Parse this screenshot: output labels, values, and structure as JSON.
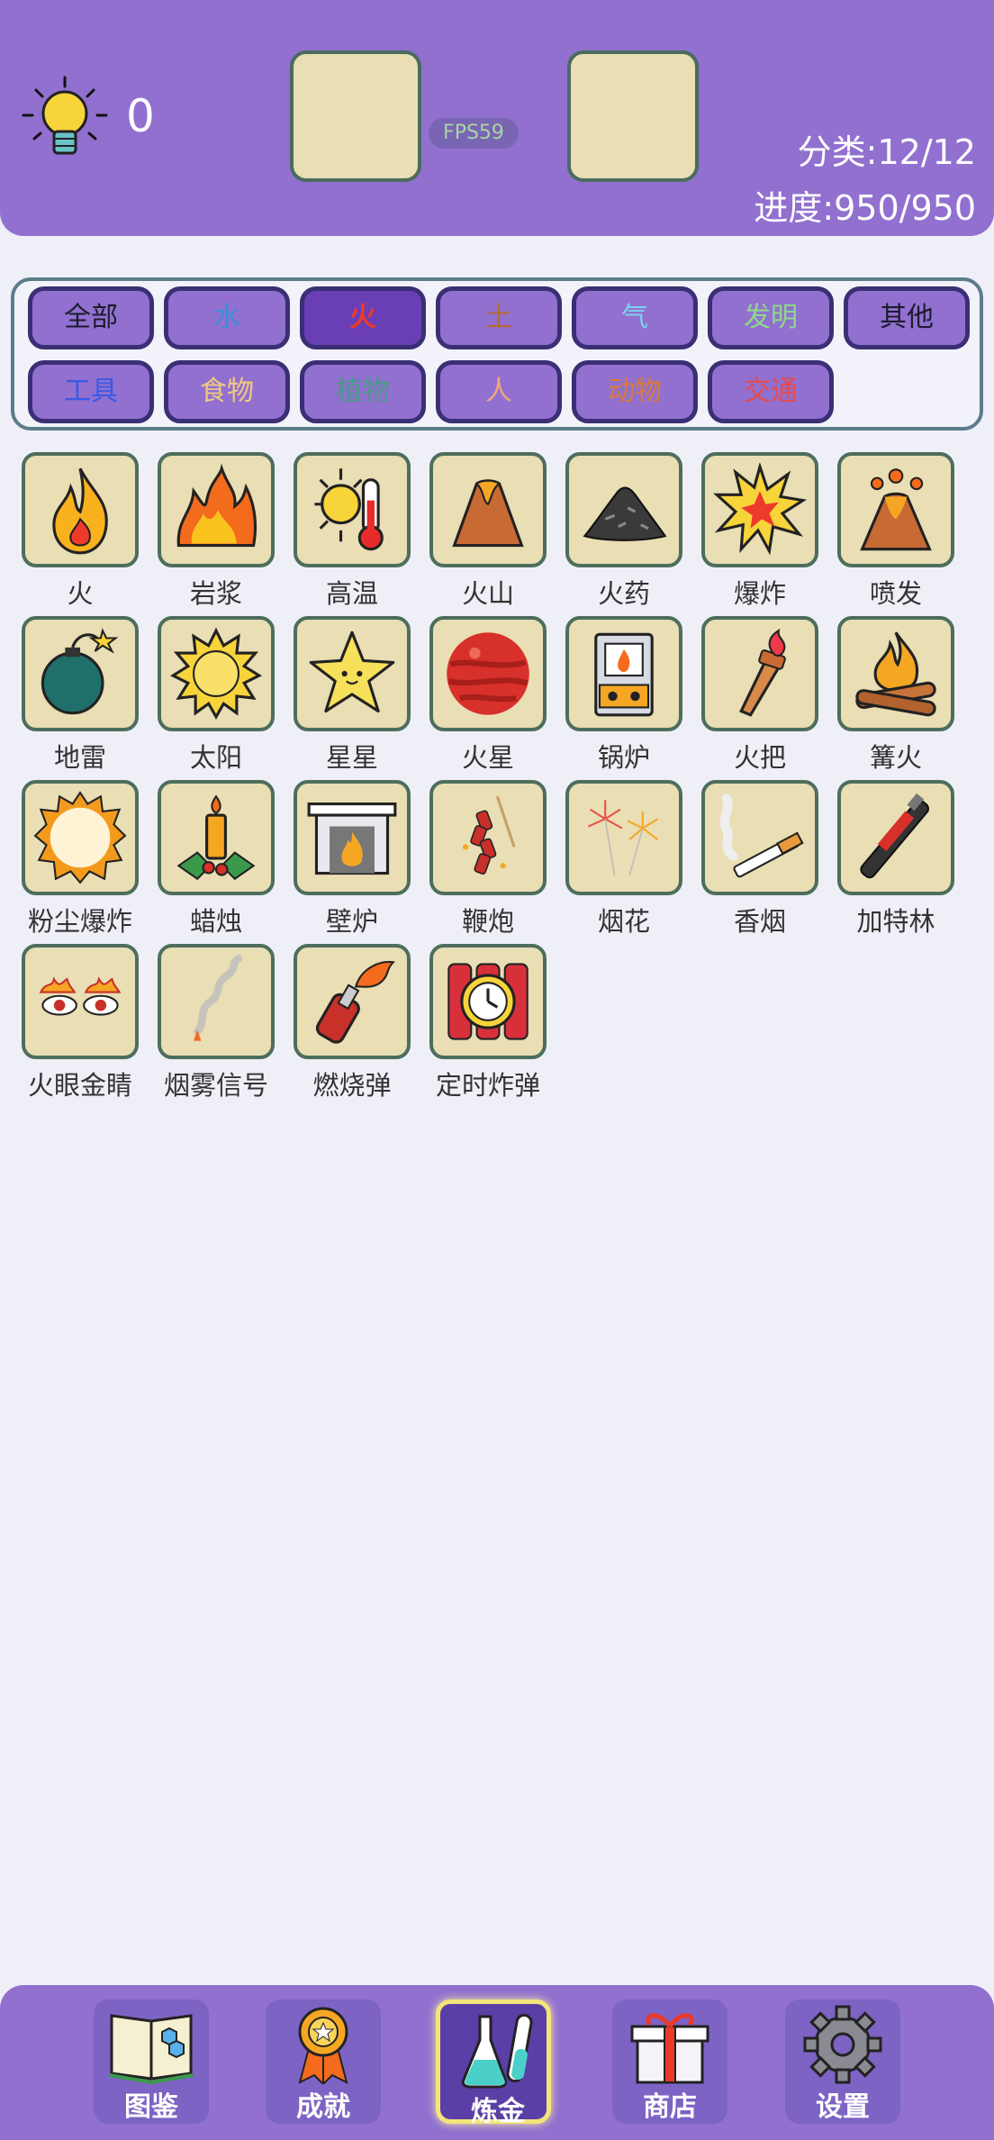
{
  "header": {
    "hint_count": "0",
    "fps": "FPS59",
    "category_count": "分类:12/12",
    "progress": "进度:950/950"
  },
  "filters": [
    {
      "label": "全部",
      "color": "#1b1b2e",
      "active": false
    },
    {
      "label": "水",
      "color": "#3b8fd8",
      "active": false
    },
    {
      "label": "火",
      "color": "#ee3a2a",
      "active": true
    },
    {
      "label": "土",
      "color": "#b36a3a",
      "active": false
    },
    {
      "label": "气",
      "color": "#7fd0ee",
      "active": false
    },
    {
      "label": "发明",
      "color": "#8fd88a",
      "active": false
    },
    {
      "label": "其他",
      "color": "#1b1b2e",
      "active": false
    },
    {
      "label": "工具",
      "color": "#3a5ae8",
      "active": false
    },
    {
      "label": "食物",
      "color": "#f0c882",
      "active": false
    },
    {
      "label": "植物",
      "color": "#4a9a8a",
      "active": false
    },
    {
      "label": "人",
      "color": "#f0a87a",
      "active": false
    },
    {
      "label": "动物",
      "color": "#d87a3a",
      "active": false
    },
    {
      "label": "交通",
      "color": "#e84a4a",
      "active": false
    }
  ],
  "items": [
    {
      "name": "火",
      "icon": "fire-icon"
    },
    {
      "name": "岩浆",
      "icon": "magma-icon"
    },
    {
      "name": "高温",
      "icon": "high-temperature-icon"
    },
    {
      "name": "火山",
      "icon": "volcano-icon"
    },
    {
      "name": "火药",
      "icon": "gunpowder-icon"
    },
    {
      "name": "爆炸",
      "icon": "explosion-icon"
    },
    {
      "name": "喷发",
      "icon": "eruption-icon"
    },
    {
      "name": "地雷",
      "icon": "bomb-icon"
    },
    {
      "name": "太阳",
      "icon": "sun-icon"
    },
    {
      "name": "星星",
      "icon": "star-icon"
    },
    {
      "name": "火星",
      "icon": "mars-icon"
    },
    {
      "name": "锅炉",
      "icon": "boiler-icon"
    },
    {
      "name": "火把",
      "icon": "torch-icon"
    },
    {
      "name": "篝火",
      "icon": "campfire-icon"
    },
    {
      "name": "粉尘爆炸",
      "icon": "dust-explosion-icon"
    },
    {
      "name": "蜡烛",
      "icon": "candle-icon"
    },
    {
      "name": "壁炉",
      "icon": "fireplace-icon"
    },
    {
      "name": "鞭炮",
      "icon": "firecracker-icon"
    },
    {
      "name": "烟花",
      "icon": "fireworks-icon"
    },
    {
      "name": "香烟",
      "icon": "cigarette-icon"
    },
    {
      "name": "加特林",
      "icon": "gatling-icon"
    },
    {
      "name": "火眼金睛",
      "icon": "fiery-eyes-icon"
    },
    {
      "name": "烟雾信号",
      "icon": "smoke-signal-icon"
    },
    {
      "name": "燃烧弹",
      "icon": "molotov-icon"
    },
    {
      "name": "定时炸弹",
      "icon": "time-bomb-icon"
    }
  ],
  "nav": [
    {
      "label": "图鉴",
      "icon": "book-icon",
      "active": false
    },
    {
      "label": "成就",
      "icon": "medal-icon",
      "active": false
    },
    {
      "label": "炼金",
      "icon": "flask-icon",
      "active": true
    },
    {
      "label": "商店",
      "icon": "gift-icon",
      "active": false
    },
    {
      "label": "设置",
      "icon": "gear-icon",
      "active": false
    }
  ]
}
